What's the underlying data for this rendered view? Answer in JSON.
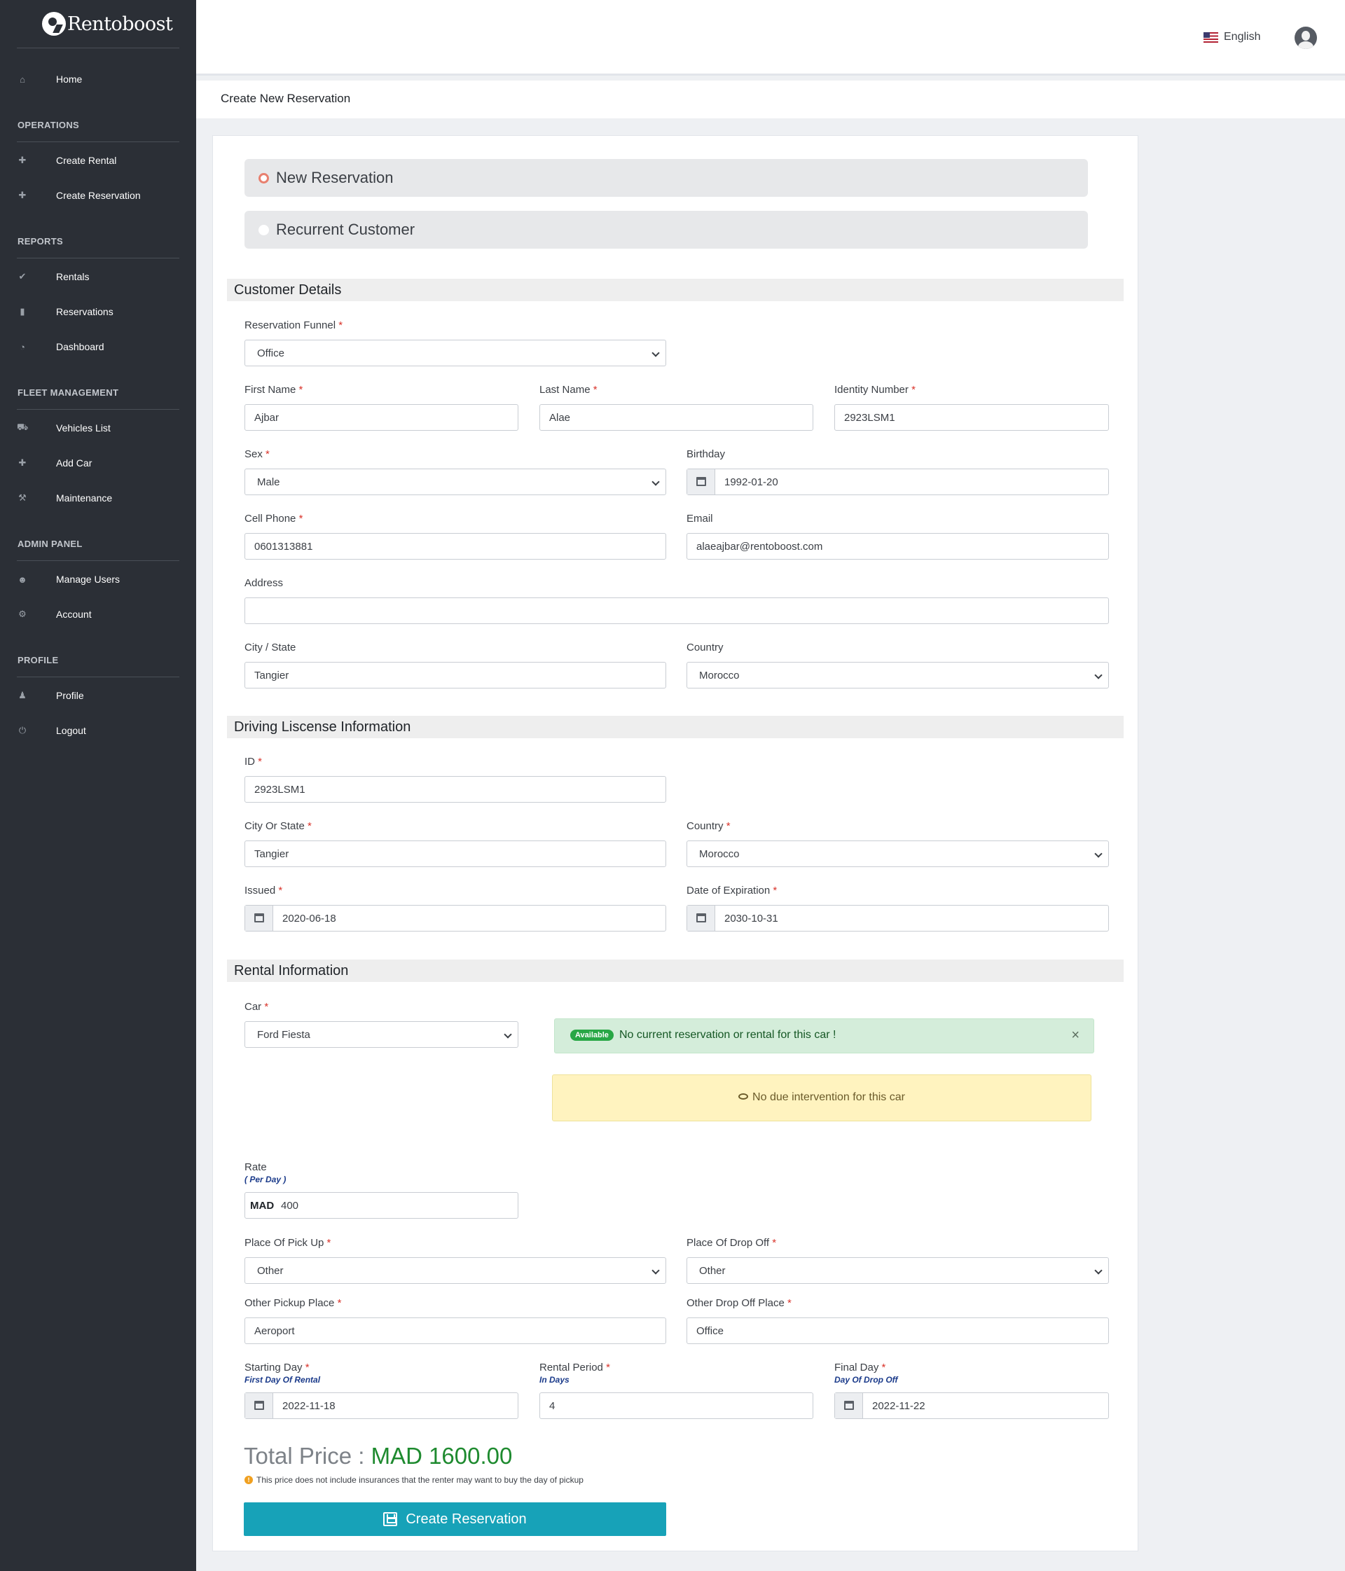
{
  "app": {
    "logo_text": "Rentoboost"
  },
  "sidebar": {
    "home": {
      "label": "Home",
      "icon": "home-icon"
    },
    "sections": {
      "operations": "OPERATIONS",
      "reports": "REPORTS",
      "fleet": "FLEET MANAGEMENT",
      "admin": "ADMIN PANEL",
      "profile": "PROFILE"
    },
    "items": {
      "create_rental": "Create Rental",
      "create_reservation": "Create Reservation",
      "rentals": "Rentals",
      "reservations": "Reservations",
      "dashboard": "Dashboard",
      "vehicles_list": "Vehicles List",
      "add_car": "Add Car",
      "maintenance": "Maintenance",
      "manage_users": "Manage Users",
      "account": "Account",
      "profile": "Profile",
      "logout": "Logout"
    }
  },
  "topbar": {
    "language": "English"
  },
  "page": {
    "title": "Create New Reservation"
  },
  "mode": {
    "options": [
      "New Reservation",
      "Recurrent Customer"
    ],
    "selected": "New Reservation"
  },
  "customer": {
    "section_title": "Customer Details",
    "reservation_funnel": {
      "label": "Reservation Funnel",
      "value": "Office"
    },
    "first_name": {
      "label": "First Name",
      "value": "Ajbar"
    },
    "last_name": {
      "label": "Last Name",
      "value": "Alae"
    },
    "identity_number": {
      "label": "Identity Number",
      "value": "2923LSM1"
    },
    "sex": {
      "label": "Sex",
      "value": "Male"
    },
    "birthday": {
      "label": "Birthday",
      "value": "1992-01-20"
    },
    "cell_phone": {
      "label": "Cell Phone",
      "value": "0601313881"
    },
    "email": {
      "label": "Email",
      "value": "alaeajbar@rentoboost.com"
    },
    "address": {
      "label": "Address",
      "value": ""
    },
    "city": {
      "label": "City / State",
      "value": "Tangier"
    },
    "country": {
      "label": "Country",
      "value": "Morocco"
    }
  },
  "license": {
    "section_title": "Driving Liscense Information",
    "id": {
      "label": "ID",
      "value": "2923LSM1"
    },
    "city": {
      "label": "City Or State",
      "value": "Tangier"
    },
    "country": {
      "label": "Country",
      "value": "Morocco"
    },
    "issued": {
      "label": "Issued",
      "value": "2020-06-18"
    },
    "expiration": {
      "label": "Date of Expiration",
      "value": "2030-10-31"
    }
  },
  "rental": {
    "section_title": "Rental Information",
    "car": {
      "label": "Car",
      "value": "Ford Fiesta"
    },
    "availability": {
      "badge": "Available",
      "message": "No current reservation or rental for this car !",
      "close": "×"
    },
    "maintenance_note": "No due intervention for this car",
    "rate": {
      "label": "Rate",
      "sublabel": "( Per Day )",
      "currency": "MAD",
      "value": "400"
    },
    "pickup_place": {
      "label": "Place Of Pick Up",
      "value": "Other"
    },
    "dropoff_place": {
      "label": "Place Of Drop Off",
      "value": "Other"
    },
    "other_pickup": {
      "label": "Other Pickup Place",
      "value": "Aeroport"
    },
    "other_dropoff": {
      "label": "Other Drop Off Place",
      "value": "Office"
    },
    "starting_day": {
      "label": "Starting Day",
      "sublabel": "First Day Of Rental",
      "value": "2022-11-18"
    },
    "rental_period": {
      "label": "Rental Period",
      "sublabel": "In Days",
      "value": "4"
    },
    "final_day": {
      "label": "Final Day",
      "sublabel": "Day Of Drop Off",
      "value": "2022-11-22"
    }
  },
  "summary": {
    "total_label": "Total Price :",
    "total_value": "MAD 1600.00",
    "note": "This price does not include insurances that the renter may want to buy the day of pickup",
    "submit_label": "Create Reservation"
  },
  "required_marker": "*",
  "colors": {
    "sidebar_bg": "#2b2f36",
    "accent_button": "#17a2b8",
    "total_green": "#1e8a2f",
    "required_red": "#d9342b"
  }
}
